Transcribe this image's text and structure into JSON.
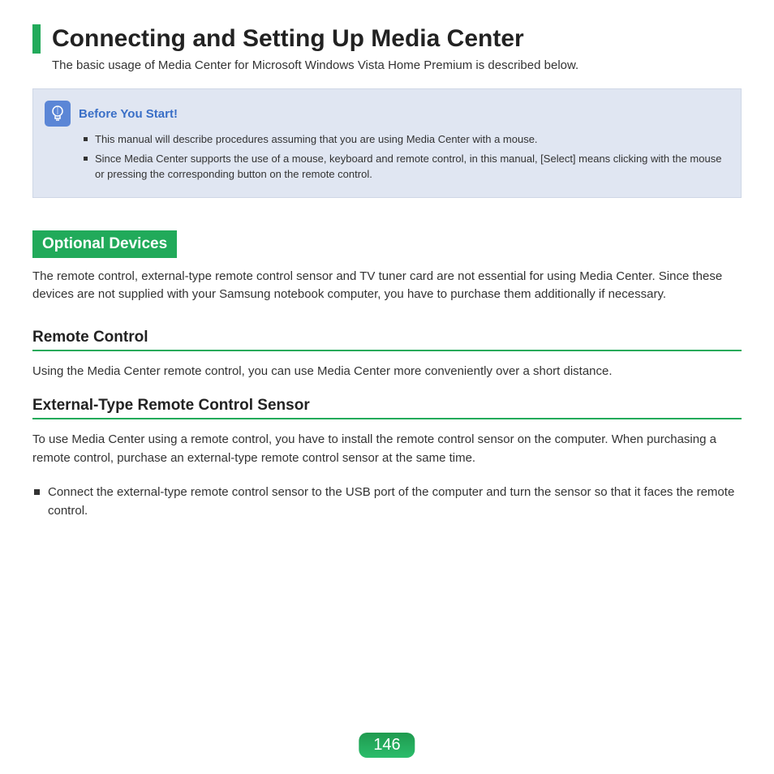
{
  "header": {
    "title": "Connecting and Setting Up Media Center",
    "intro": "The basic usage of Media Center for Microsoft Windows Vista Home Premium is described below."
  },
  "note": {
    "title": "Before You Start!",
    "items": [
      "This manual will describe procedures assuming that you are using Media Center with a mouse.",
      "Since Media Center supports the use of a mouse, keyboard and remote control, in this manual, [Select] means clicking with the mouse or pressing the corresponding button on the remote control."
    ]
  },
  "optional_devices": {
    "badge": "Optional Devices",
    "text": "The remote control, external-type remote control sensor and TV tuner card are not essential for using Media Center. Since these devices are not supplied with your Samsung notebook computer, you have to purchase them additionally if necessary."
  },
  "remote_control": {
    "heading": "Remote Control",
    "text": "Using the Media Center remote control, you can use Media Center more conveniently over a short distance."
  },
  "sensor": {
    "heading": "External-Type Remote Control Sensor",
    "text": "To use Media Center using a remote control, you have to install the remote control sensor on the computer. When purchasing a remote control, purchase an external-type remote control sensor at the same time.",
    "bullet": "Connect the external-type remote control sensor to the USB port of the computer and turn the sensor so that it faces the remote control."
  },
  "page_number": "146"
}
